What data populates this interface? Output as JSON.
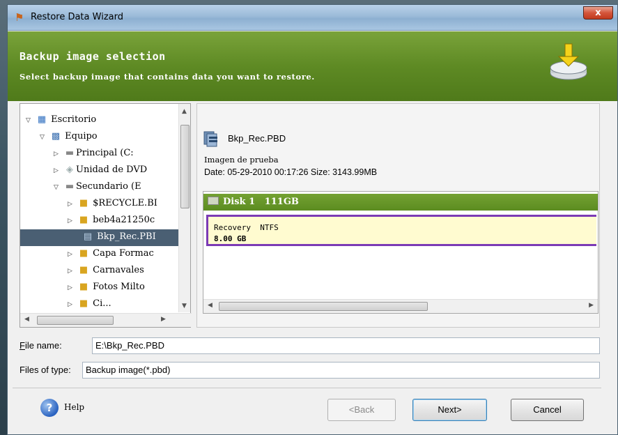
{
  "window": {
    "title": "Restore Data Wizard",
    "close_label": "x"
  },
  "banner": {
    "title": "Backup image selection",
    "subtitle": "Select backup image that contains data you want to restore."
  },
  "tree": {
    "items": [
      {
        "label": "Escritorio",
        "icon": "desktop-icon",
        "expanded": true
      },
      {
        "label": "Equipo",
        "icon": "computer-icon",
        "expanded": true
      },
      {
        "label": "Principal (C:",
        "icon": "drive-icon",
        "expanded": false
      },
      {
        "label": "Unidad de DVD",
        "icon": "dvd-drive-icon",
        "expanded": false
      },
      {
        "label": "Secundario (E",
        "icon": "drive-icon",
        "expanded": true
      },
      {
        "label": "$RECYCLE.BI",
        "icon": "folder-icon",
        "expanded": false
      },
      {
        "label": "beb4a21250c",
        "icon": "folder-icon",
        "expanded": false
      },
      {
        "label": "Bkp_Rec.PBI",
        "icon": "backup-file-icon",
        "selected": true
      },
      {
        "label": "Capa Formac",
        "icon": "folder-icon",
        "expanded": false
      },
      {
        "label": "Carnavales",
        "icon": "folder-icon",
        "expanded": false
      },
      {
        "label": "Fotos Milto",
        "icon": "folder-icon",
        "expanded": false
      },
      {
        "label": "Ci...",
        "icon": "folder-icon",
        "expanded": false
      }
    ]
  },
  "image_info": {
    "name": "Bkp_Rec.PBD",
    "description": "Imagen de prueba",
    "meta": "Date: 05-29-2010 00:17:26 Size: 3143.99MB"
  },
  "disk": {
    "label": "Disk 1   111GB",
    "partition_name": "Recovery  NTFS",
    "partition_size": "8.00 GB"
  },
  "fields": {
    "file_name_label": "File name:",
    "file_name_value": "E:\\Bkp_Rec.PBD",
    "file_type_label": "Files of type:",
    "file_type_value": "Backup image(*.pbd)"
  },
  "footer": {
    "help_label": "Help",
    "back_label": "<Back",
    "next_label": "Next>",
    "cancel_label": "Cancel"
  },
  "colors": {
    "banner_green": "#5e8a24",
    "disk_green": "#5c8c20",
    "partition_purple": "#7b3ab5",
    "partition_fill": "#fffbd0",
    "selection": "#4a5f73"
  }
}
